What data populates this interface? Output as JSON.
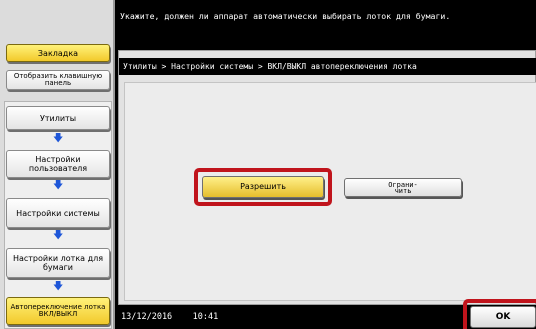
{
  "message": "Укажите, должен ли аппарат автоматически выбирать лоток для бумаги.",
  "sidebar": {
    "bookmark": "Закладка",
    "show_keypad": "Отобразить клавишную панель",
    "path": [
      "Утилиты",
      "Настройки пользователя",
      "Настройки системы",
      "Настройки лотка для бумаги",
      "Автопереключение лотка ВКЛ/ВЫКЛ"
    ]
  },
  "breadcrumb": "Утилиты > Настройки системы > ВКЛ/ВЫКЛ автопереключения лотка",
  "options": {
    "allow": "Разрешить",
    "restrict": "Ограни-\nчить"
  },
  "status": {
    "date": "13/12/2016",
    "time": "10:41"
  },
  "ok_label": "OK",
  "colors": {
    "highlight": "#c0141c",
    "selected_yellow": "#f2c92b",
    "arrow_blue": "#1e56d8"
  }
}
